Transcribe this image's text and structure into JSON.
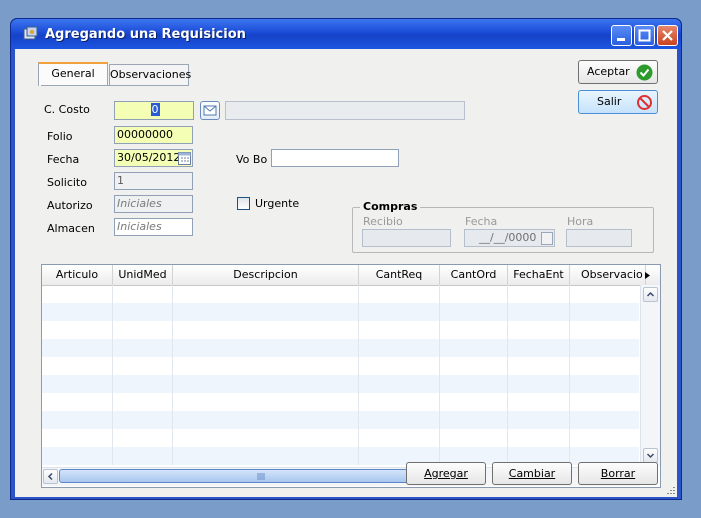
{
  "window": {
    "title": "Agregando una Requisicion"
  },
  "tabs": [
    {
      "label": "General"
    },
    {
      "label": "Observaciones"
    }
  ],
  "buttons": {
    "aceptar": "Aceptar",
    "salir": "Salir",
    "agregar": "Agregar",
    "cambiar": "Cambiar",
    "borrar": "Borrar"
  },
  "form": {
    "c_costo": {
      "label": "C. Costo",
      "value": "0"
    },
    "folio": {
      "label": "Folio",
      "value": "00000000"
    },
    "fecha": {
      "label": "Fecha",
      "value": "30/05/2012"
    },
    "solicito": {
      "label": "Solicito",
      "value": "1"
    },
    "autorizo": {
      "label": "Autorizo",
      "placeholder": "Iniciales"
    },
    "almacen": {
      "label": "Almacen",
      "placeholder": "Iniciales"
    },
    "vobo": {
      "label": "Vo Bo",
      "value": ""
    },
    "urgente": {
      "label": "Urgente",
      "checked": false
    }
  },
  "compras": {
    "title": "Compras",
    "recibio_label": "Recibio",
    "fecha_label": "Fecha",
    "fecha_value": "__/__/0000",
    "hora_label": "Hora"
  },
  "grid": {
    "columns": [
      "Articulo",
      "UnidMed",
      "Descripcion",
      "CantReq",
      "CantOrd",
      "FechaEnt",
      "Observacio"
    ],
    "rows": []
  },
  "colors": {
    "titlebar": "#1a4bd6",
    "input_highlight": "#f4ffb5",
    "tab_accent": "#f2a03d",
    "ok_green": "#2d9a2d",
    "exit_red": "#e03030"
  },
  "icons": {
    "app": "app-icon",
    "aceptar": "check-icon",
    "salir": "no-entry-icon",
    "lookup": "envelope-icon",
    "calendar": "calendar-icon"
  }
}
